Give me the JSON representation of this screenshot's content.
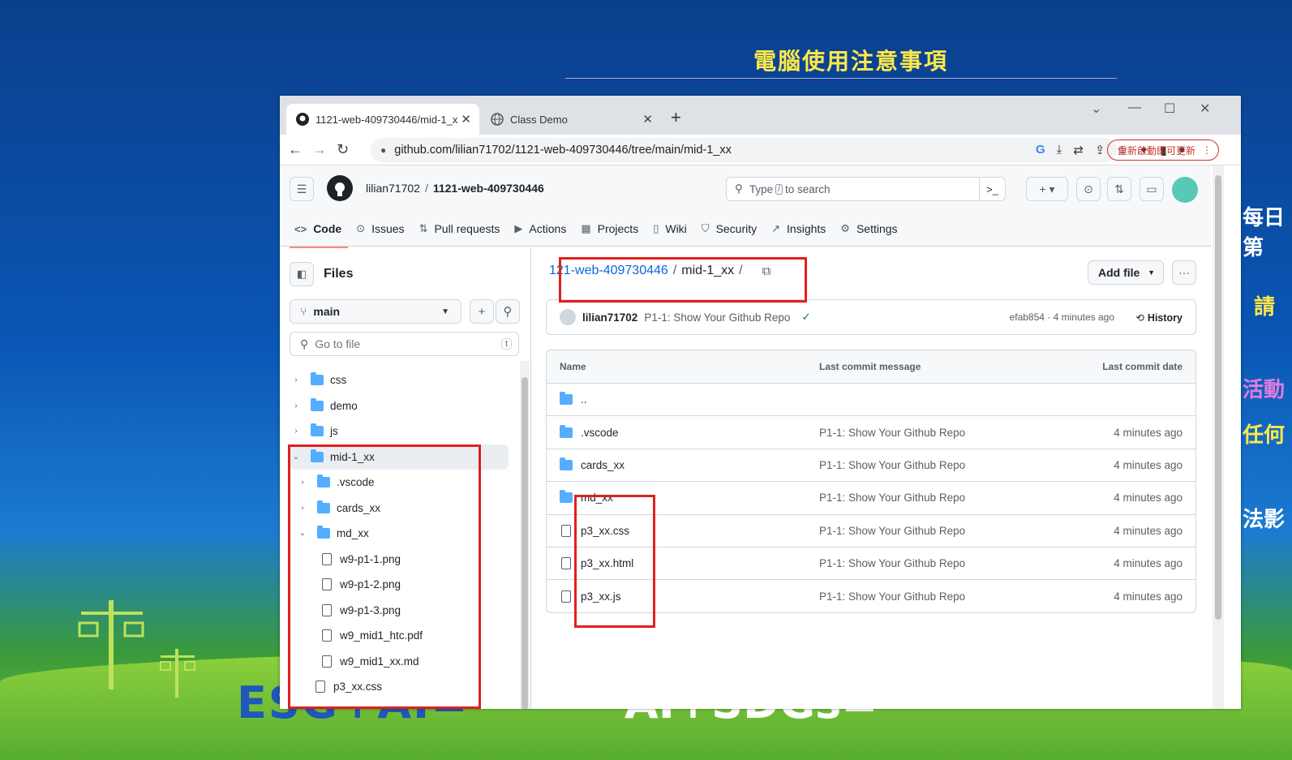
{
  "slide": {
    "title": "電腦使用注意事項",
    "side_1": "每日第",
    "side_2": "，請",
    "side_3": "活動",
    "side_4": "任何",
    "side_5": "法影",
    "banner_left": "ESG+AI=",
    "banner_right": "AI+SDGs="
  },
  "browser": {
    "tabs": [
      {
        "title": "1121-web-409730446/mid-1_x"
      },
      {
        "title": "Class Demo"
      }
    ],
    "url": "github.com/lilian71702/1121-web-409730446/tree/main/mid-1_xx",
    "update_label": "重新啟動即可更新"
  },
  "github": {
    "owner": "lilian71702",
    "repo": "1121-web-409730446",
    "search_placeholder": "Type",
    "search_kbd": "/",
    "search_suffix": "to search",
    "nav": [
      {
        "label": "Code"
      },
      {
        "label": "Issues"
      },
      {
        "label": "Pull requests"
      },
      {
        "label": "Actions"
      },
      {
        "label": "Projects"
      },
      {
        "label": "Wiki"
      },
      {
        "label": "Security"
      },
      {
        "label": "Insights"
      },
      {
        "label": "Settings"
      }
    ],
    "sidebar": {
      "title": "Files",
      "branch": "main",
      "go_to_file": "Go to file",
      "go_to_file_key": "t",
      "tree": [
        {
          "name": "css"
        },
        {
          "name": "demo"
        },
        {
          "name": "js"
        },
        {
          "name": "mid-1_xx"
        },
        {
          "name": ".vscode"
        },
        {
          "name": "cards_xx"
        },
        {
          "name": "md_xx"
        },
        {
          "name": "w9-p1-1.png"
        },
        {
          "name": "w9-p1-2.png"
        },
        {
          "name": "w9-p1-3.png"
        },
        {
          "name": "w9_mid1_htc.pdf"
        },
        {
          "name": "w9_mid1_xx.md"
        },
        {
          "name": "p3_xx.css"
        }
      ]
    },
    "main": {
      "path_repo": "121-web-409730446",
      "path_dir": "mid-1_xx",
      "add_file": "Add file",
      "commit": {
        "author": "lilian71702",
        "message": "P1-1: Show Your Github Repo",
        "hash_time": "efab854 · 4 minutes ago",
        "history": "History"
      },
      "columns": [
        "Name",
        "Last commit message",
        "Last commit date"
      ],
      "parent": "..",
      "rows": [
        {
          "name": ".vscode",
          "msg": "P1-1: Show Your Github Repo",
          "date": "4 minutes ago"
        },
        {
          "name": "cards_xx",
          "msg": "P1-1: Show Your Github Repo",
          "date": "4 minutes ago"
        },
        {
          "name": "md_xx",
          "msg": "P1-1: Show Your Github Repo",
          "date": "4 minutes ago"
        },
        {
          "name": "p3_xx.css",
          "msg": "P1-1: Show Your Github Repo",
          "date": "4 minutes ago"
        },
        {
          "name": "p3_xx.html",
          "msg": "P1-1: Show Your Github Repo",
          "date": "4 minutes ago"
        },
        {
          "name": "p3_xx.js",
          "msg": "P1-1: Show Your Github Repo",
          "date": "4 minutes ago"
        }
      ]
    }
  },
  "colors": {
    "highlight": "#e0201d",
    "link": "#0969da",
    "folder": "#54aeff"
  }
}
